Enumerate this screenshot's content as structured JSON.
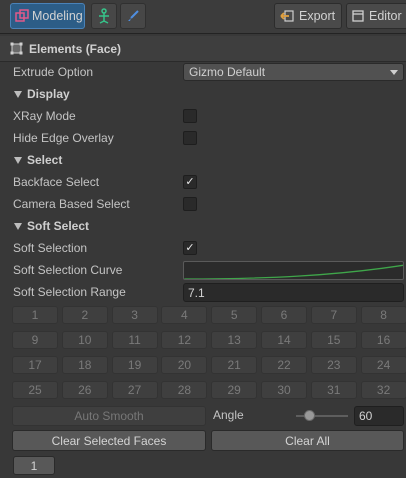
{
  "toolbar": {
    "modeling_label": "Modeling",
    "export_label": "Export",
    "editor_label": "Editor"
  },
  "header": {
    "title": "Elements (Face)"
  },
  "extrude": {
    "label": "Extrude Option",
    "value": "Gizmo Default"
  },
  "display": {
    "title": "Display",
    "xray_label": "XRay Mode",
    "xray_checked": false,
    "hide_edge_label": "Hide Edge Overlay",
    "hide_edge_checked": false
  },
  "select": {
    "title": "Select",
    "backface_label": "Backface Select",
    "backface_checked": true,
    "camera_label": "Camera Based Select",
    "camera_checked": false
  },
  "soft_select": {
    "title": "Soft Select",
    "soft_selection_label": "Soft Selection",
    "soft_selection_checked": true,
    "curve_label": "Soft Selection Curve",
    "range_label": "Soft Selection Range",
    "range_value": "7.1"
  },
  "smoothing_groups": [
    "1",
    "2",
    "3",
    "4",
    "5",
    "6",
    "7",
    "8",
    "9",
    "10",
    "11",
    "12",
    "13",
    "14",
    "15",
    "16",
    "17",
    "18",
    "19",
    "20",
    "21",
    "22",
    "23",
    "24",
    "25",
    "26",
    "27",
    "28",
    "29",
    "30",
    "31",
    "32"
  ],
  "auto_smooth_label": "Auto Smooth",
  "angle": {
    "label": "Angle",
    "value": "60",
    "fraction": 0.25
  },
  "clear_selected_faces_label": "Clear Selected Faces",
  "clear_all_label": "Clear All",
  "page_label": "1",
  "colors": {
    "accent": "#2c5d87",
    "curve": "#3fa64a",
    "background": "#383838"
  }
}
